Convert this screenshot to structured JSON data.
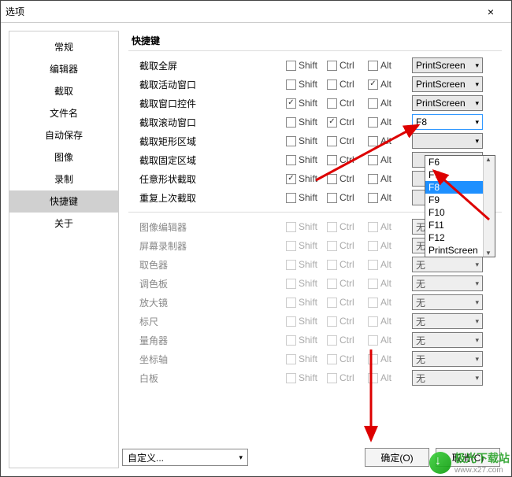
{
  "window": {
    "title": "选项",
    "close": "×"
  },
  "sidebar": {
    "items": [
      {
        "label": "常规"
      },
      {
        "label": "编辑器"
      },
      {
        "label": "截取"
      },
      {
        "label": "文件名"
      },
      {
        "label": "自动保存"
      },
      {
        "label": "图像"
      },
      {
        "label": "录制"
      },
      {
        "label": "快捷键"
      },
      {
        "label": "关于"
      }
    ],
    "active_index": 7
  },
  "section": {
    "title": "快捷键"
  },
  "mods": {
    "shift": "Shift",
    "ctrl": "Ctrl",
    "alt": "Alt"
  },
  "groups": [
    {
      "rows": [
        {
          "label": "截取全屏",
          "shift": false,
          "ctrl": false,
          "alt": false,
          "key": "PrintScreen",
          "enabled": true
        },
        {
          "label": "截取活动窗口",
          "shift": false,
          "ctrl": false,
          "alt": true,
          "key": "PrintScreen",
          "enabled": true
        },
        {
          "label": "截取窗口控件",
          "shift": true,
          "ctrl": false,
          "alt": false,
          "key": "PrintScreen",
          "enabled": true
        },
        {
          "label": "截取滚动窗口",
          "shift": false,
          "ctrl": true,
          "alt": false,
          "key": "F8",
          "enabled": true,
          "open": true
        },
        {
          "label": "截取矩形区域",
          "shift": false,
          "ctrl": false,
          "alt": false,
          "key": "",
          "enabled": true
        },
        {
          "label": "截取固定区域",
          "shift": false,
          "ctrl": false,
          "alt": false,
          "key": "",
          "enabled": true
        },
        {
          "label": "任意形状截取",
          "shift": true,
          "ctrl": false,
          "alt": false,
          "key": "",
          "enabled": true
        },
        {
          "label": "重复上次截取",
          "shift": false,
          "ctrl": false,
          "alt": false,
          "key": "",
          "enabled": true
        }
      ]
    },
    {
      "rows": [
        {
          "label": "图像编辑器",
          "shift": false,
          "ctrl": false,
          "alt": false,
          "key": "无",
          "enabled": false
        },
        {
          "label": "屏幕录制器",
          "shift": false,
          "ctrl": false,
          "alt": false,
          "key": "无",
          "enabled": false
        },
        {
          "label": "取色器",
          "shift": false,
          "ctrl": false,
          "alt": false,
          "key": "无",
          "enabled": false
        },
        {
          "label": "调色板",
          "shift": false,
          "ctrl": false,
          "alt": false,
          "key": "无",
          "enabled": false
        },
        {
          "label": "放大镜",
          "shift": false,
          "ctrl": false,
          "alt": false,
          "key": "无",
          "enabled": false
        },
        {
          "label": "标尺",
          "shift": false,
          "ctrl": false,
          "alt": false,
          "key": "无",
          "enabled": false
        },
        {
          "label": "量角器",
          "shift": false,
          "ctrl": false,
          "alt": false,
          "key": "无",
          "enabled": false
        },
        {
          "label": "坐标轴",
          "shift": false,
          "ctrl": false,
          "alt": false,
          "key": "无",
          "enabled": false
        },
        {
          "label": "白板",
          "shift": false,
          "ctrl": false,
          "alt": false,
          "key": "无",
          "enabled": false
        }
      ]
    }
  ],
  "dropdown": {
    "options": [
      "F6",
      "F7",
      "F8",
      "F9",
      "F10",
      "F11",
      "F12",
      "PrintScreen"
    ],
    "selected_index": 2
  },
  "preset": {
    "label": "自定义..."
  },
  "buttons": {
    "ok": "确定(O)",
    "cancel": "取消(C)"
  },
  "watermark": {
    "brand": "极光下载站",
    "url": "www.x27.com"
  }
}
